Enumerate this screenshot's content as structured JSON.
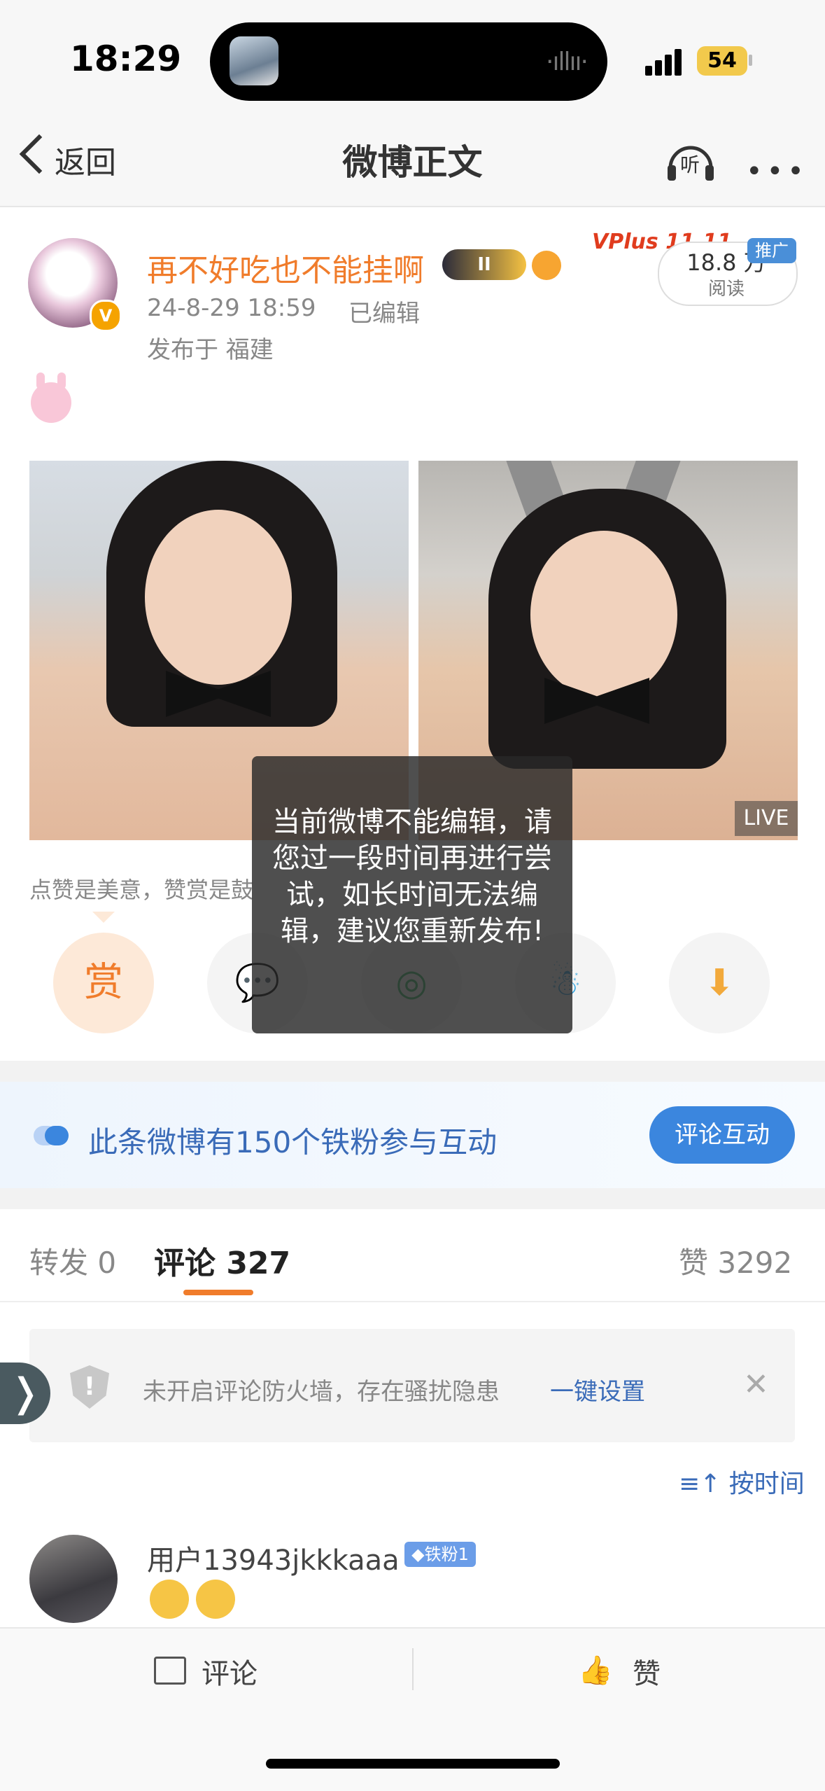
{
  "status_bar": {
    "time": "18:29",
    "battery": "54"
  },
  "nav": {
    "back_label": "返回",
    "title": "微博正文",
    "listen_label": "听"
  },
  "author": {
    "name": "再不好吃也不能挂啊",
    "level_badge": "II",
    "verified": "V"
  },
  "post_meta": {
    "time": "24-8-29 18:59",
    "edited": "已编辑",
    "location": "发布于 福建"
  },
  "promo": {
    "text": "VPlus 11.11",
    "tag": "推广",
    "reads_count": "18.8 万",
    "reads_label": "阅读"
  },
  "media": {
    "live_label": "LIVE"
  },
  "caption": "点赞是美意，赞赏是鼓",
  "share": {
    "reward_label": "赏"
  },
  "toast": {
    "message": "当前微博不能编辑，请您过一段时间再进行尝试，如长时间无法编辑，建议您重新发布!"
  },
  "fans": {
    "text": "此条微博有150个铁粉参与互动",
    "button": "评论互动"
  },
  "tabs": {
    "repost": "转发 0",
    "comment": "评论 327",
    "like": "赞 3292"
  },
  "firewall": {
    "text": "未开启评论防火墙，存在骚扰隐患",
    "link": "一键设置",
    "close": "✕"
  },
  "sort": {
    "label": "按时间"
  },
  "comment": {
    "user": "用户13943jkkkaaa",
    "badge": "◆铁粉1"
  },
  "bottom": {
    "comment_label": "评论",
    "like_label": "赞"
  },
  "colors": {
    "accent": "#f07c2b",
    "link": "#3a6bb8",
    "button": "#3b86de"
  }
}
